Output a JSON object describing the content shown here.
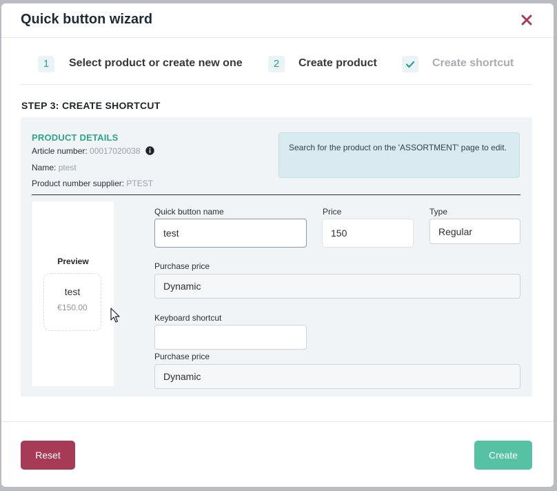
{
  "modal": {
    "title": "Quick button wizard"
  },
  "steps": [
    {
      "marker": "1",
      "label": "Select product or create new one"
    },
    {
      "marker": "2",
      "label": "Create product"
    },
    {
      "marker": "check-icon",
      "label": "Create shortcut"
    }
  ],
  "section_title": "STEP 3: CREATE SHORTCUT",
  "product_details": {
    "title": "PRODUCT DETAILS",
    "article_label": "Article number:",
    "article_value": "00017020038",
    "name_label": "Name:",
    "name_value": "ptest",
    "supplier_label": "Product number supplier:",
    "supplier_value": "PTEST"
  },
  "notice": "Search for the product on the 'ASSORTMENT' page to edit.",
  "preview": {
    "title": "Preview",
    "name": "test",
    "price": "€150.00"
  },
  "form": {
    "quick_name_label": "Quick button name",
    "quick_name_value": "test",
    "price_label": "Price",
    "price_value": "150",
    "type_label": "Type",
    "type_value": "Regular",
    "purchase_price_label": "Purchase price",
    "purchase_price_value": "Dynamic",
    "keyboard_label": "Keyboard shortcut",
    "keyboard_value": "",
    "purchase_price2_label": "Purchase price",
    "purchase_price2_value": "Dynamic"
  },
  "footer": {
    "reset_label": "Reset",
    "create_label": "Create"
  },
  "colors": {
    "accent_green": "#56c2a3",
    "reset_red": "#a73b56",
    "title_green": "#2ea58a",
    "close_red": "#a73b56"
  }
}
